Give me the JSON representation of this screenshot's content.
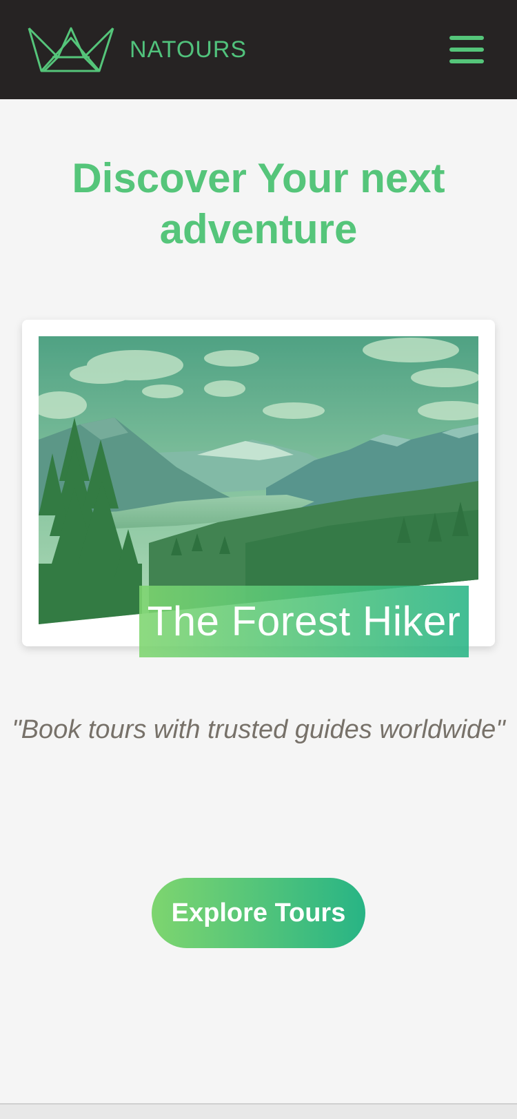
{
  "header": {
    "brand": "NATOURS",
    "logo_icon": "crown-logo-icon",
    "menu_icon": "hamburger-menu-icon"
  },
  "hero": {
    "headline": "Discover Your next adventure",
    "card_title": "The Forest Hiker",
    "card_image": "mountain-forest-landscape",
    "tagline": "\"Book tours with trusted guides worldwide\"",
    "cta_label": "Explore Tours"
  },
  "colors": {
    "primary": "#55c57a",
    "gradient_start": "#7ed56f",
    "gradient_end": "#28b485",
    "header_bg": "#262323",
    "text_grey": "#777169"
  }
}
